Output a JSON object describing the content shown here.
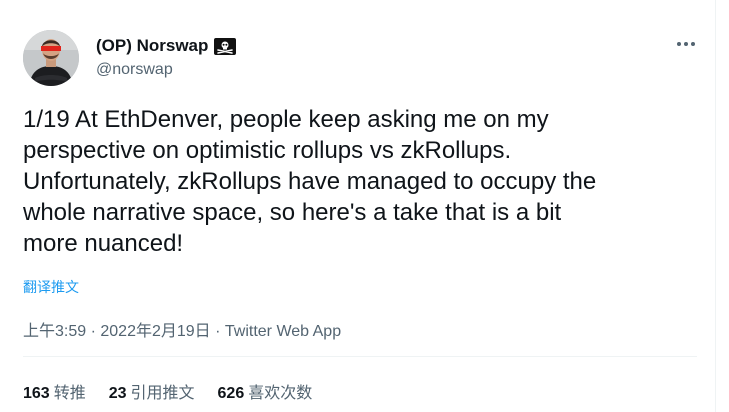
{
  "author": {
    "display_name": "(OP) Norswap",
    "handle": "@norswap",
    "name_icon": "pirate-flag-icon"
  },
  "menu": {
    "icon": "more-options-icon"
  },
  "tweet": {
    "lines": [
      "1/19 At EthDenver, people keep asking me on my",
      "perspective on optimistic rollups vs zkRollups.",
      "Unfortunately, zkRollups have managed to occupy the",
      "whole narrative space, so here's a take that is a bit",
      "more nuanced!"
    ],
    "translate_label": "翻译推文"
  },
  "meta": {
    "time": "上午3:59",
    "separator1": " · ",
    "date": "2022年2月19日",
    "separator2": " · ",
    "source": "Twitter Web App"
  },
  "stats": [
    {
      "count": "163",
      "label": "转推"
    },
    {
      "count": "23",
      "label": "引用推文"
    },
    {
      "count": "626",
      "label": "喜欢次数"
    }
  ],
  "colors": {
    "text_primary": "#0f1419",
    "text_secondary": "#536471",
    "link": "#1d9bf0",
    "divider": "#eff3f4"
  }
}
